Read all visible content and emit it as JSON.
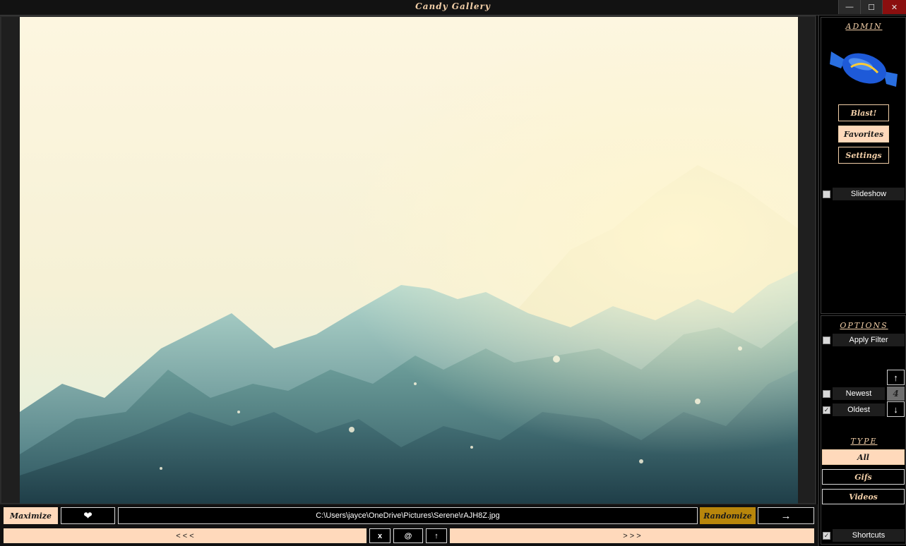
{
  "window": {
    "title": "Candy Gallery",
    "minimize_glyph": "—",
    "maximize_glyph": "☐",
    "close_glyph": "✕"
  },
  "sidebar": {
    "admin_heading": "ADMIN",
    "buttons": {
      "blast": "Blast!",
      "favorites": "Favorites",
      "settings": "Settings"
    },
    "slideshow_label": "Slideshow",
    "options_heading": "OPTIONS",
    "apply_filter_label": "Apply Filter",
    "newest_label": "Newest",
    "oldest_label": "Oldest",
    "sort_count": "4",
    "up_arrow": "↑",
    "down_arrow": "↓",
    "type_heading": "TYPE",
    "type_all": "All",
    "type_gifs": "Gifs",
    "type_videos": "Videos",
    "shortcuts_label": "Shortcuts",
    "check_mark": "✓"
  },
  "bottom_bar": {
    "maximize_label": "Maximize",
    "heart_glyph": "❤",
    "file_path": "C:\\Users\\jayce\\OneDrive\\Pictures\\Serene\\rAJH8Z.jpg",
    "randomize_label": "Randomize",
    "next_arrow": "→",
    "prev_label": "< < <",
    "x_label": "x",
    "at_label": "@",
    "up_label": "↑",
    "fwd_label": "> > >"
  },
  "colors": {
    "accent_peach": "#ffd9bb",
    "accent_gold": "#b8860b",
    "close_red": "#8b0f0f"
  }
}
